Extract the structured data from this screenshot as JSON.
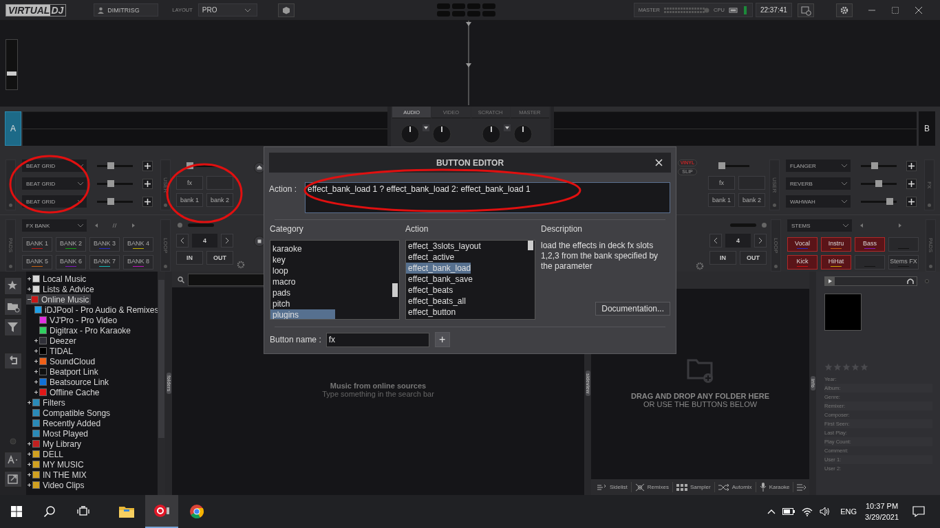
{
  "topbar": {
    "logo": {
      "part1": "VIRTUAL",
      "part2": "DJ"
    },
    "user": "DIMITRISG",
    "layout_label": "LAYOUT",
    "layout_value": "PRO",
    "master_label": "MASTER",
    "cpu_label": "CPU",
    "clock": "22:37:41"
  },
  "top_slider": {
    "level": 0.3
  },
  "mixer": {
    "tabs": [
      {
        "label": "AUDIO",
        "selected": true
      },
      {
        "label": "VIDEO",
        "selected": false
      },
      {
        "label": "SCRATCH",
        "selected": false
      },
      {
        "label": "MASTER",
        "selected": false
      }
    ]
  },
  "deck_a": {
    "label": "A",
    "pitch": {
      "level": 0
    },
    "effects": [
      {
        "name": "BEAT GRID",
        "level": 0.35
      },
      {
        "name": "BEAT GRID",
        "level": 0.35
      },
      {
        "name": "BEAT GRID",
        "level": 0.35
      }
    ],
    "user_strip": "USER",
    "user_buttons": [
      {
        "kind": "labeled",
        "label": "fx"
      },
      {
        "kind": "blank"
      },
      {
        "kind": "labeled",
        "label": "bank 1"
      },
      {
        "kind": "labeled",
        "label": "bank 2"
      }
    ],
    "pads_strip": "PADS",
    "pad_bank": "FX BANK",
    "pads": [
      {
        "kind": "labeled",
        "label": "BANK 1",
        "color": "#c01818",
        "active": false
      },
      {
        "kind": "labeled",
        "label": "BANK 2",
        "color": "#10a010",
        "active": false
      },
      {
        "kind": "labeled",
        "label": "BANK 3",
        "color": "#2828c8",
        "active": false
      },
      {
        "kind": "labeled",
        "label": "BANK 4",
        "color": "#c0b000",
        "active": false
      },
      {
        "kind": "labeled",
        "label": "BANK 5",
        "color": "#c86010",
        "active": false
      },
      {
        "kind": "labeled",
        "label": "BANK 6",
        "color": "#8018c0",
        "active": false
      },
      {
        "kind": "labeled",
        "label": "BANK 7",
        "color": "#10b8b8",
        "active": false
      },
      {
        "kind": "labeled",
        "label": "BANK 8",
        "color": "#c010c0",
        "active": false
      }
    ],
    "loop_strip": "LOOP",
    "loop_size": "4",
    "loop_in": "IN",
    "loop_out": "OUT"
  },
  "deck_b": {
    "label": "B",
    "vinyl": "VINYL",
    "slip": "SLIP",
    "pitch": {
      "level": 0
    },
    "user_buttons": [
      {
        "kind": "labeled",
        "label": "fx"
      },
      {
        "kind": "blank"
      },
      {
        "kind": "labeled",
        "label": "bank 1"
      },
      {
        "kind": "labeled",
        "label": "bank 2"
      }
    ],
    "user_strip": "USER",
    "effects": [
      {
        "name": "FLANGER",
        "level": 0.35
      },
      {
        "name": "REVERB",
        "level": 0.5
      },
      {
        "name": "WAHWAH",
        "level": 0.88
      }
    ],
    "fx_strip": "FX",
    "loop_size": "4",
    "loop_in": "IN",
    "loop_out": "OUT",
    "loop_strip": "LOOP",
    "pad_bank": "STEMS",
    "pads": [
      {
        "kind": "labeled",
        "label": "Vocal",
        "color": "#2828c8",
        "active": true
      },
      {
        "kind": "labeled",
        "label": "Instru",
        "color": "#c86010",
        "active": true
      },
      {
        "kind": "labeled",
        "label": "Bass",
        "color": "#8018c0",
        "active": true
      },
      {
        "kind": "blank",
        "color": "#111111",
        "active": false
      },
      {
        "kind": "labeled",
        "label": "Kick",
        "color": "#d01010",
        "active": true
      },
      {
        "kind": "labeled",
        "label": "HiHat",
        "color": "#d0a800",
        "active": true
      },
      {
        "kind": "blank",
        "color": "#111111",
        "active": false
      },
      {
        "kind": "labeled",
        "label": "Stems FX",
        "color": "#111111",
        "active": false
      }
    ],
    "pads_strip": "PADS"
  },
  "browser": {
    "tree": [
      {
        "label": "Local Music",
        "kind": "branch",
        "expanded": false,
        "color": "#d8d8d8",
        "selected": false
      },
      {
        "label": "Lists & Advice",
        "kind": "branch",
        "expanded": false,
        "color": "#d8d8d8",
        "selected": false
      },
      {
        "label": "Online Music",
        "kind": "branch",
        "expanded": true,
        "color": "#c81818",
        "selected": true,
        "children": [
          {
            "label": "iDJPool - Pro Audio & Remixes",
            "kind": "leaf",
            "color": "#1ea0e8",
            "selected": false
          },
          {
            "label": "VJ'Pro - Pro Video",
            "kind": "leaf",
            "color": "#e030e0",
            "selected": false
          },
          {
            "label": "Digitrax - Pro Karaoke",
            "kind": "leaf",
            "color": "#30d060",
            "selected": false
          },
          {
            "label": "Deezer",
            "kind": "branch",
            "expanded": false,
            "color": "#303038",
            "selected": false
          },
          {
            "label": "TIDAL",
            "kind": "branch",
            "expanded": false,
            "color": "#000000",
            "selected": false
          },
          {
            "label": "SoundCloud",
            "kind": "branch",
            "expanded": false,
            "color": "#f06018",
            "selected": false
          },
          {
            "label": "Beatport Link",
            "kind": "branch",
            "expanded": false,
            "color": "#101010",
            "selected": false
          },
          {
            "label": "Beatsource Link",
            "kind": "branch",
            "expanded": false,
            "color": "#1070d8",
            "selected": false
          },
          {
            "label": "Offline Cache",
            "kind": "branch",
            "expanded": false,
            "color": "#e01818",
            "selected": false
          }
        ]
      },
      {
        "label": "Filters",
        "kind": "branch",
        "expanded": false,
        "color": "#2a8ab8",
        "selected": false
      },
      {
        "label": "Compatible Songs",
        "kind": "leaf",
        "color": "#2a8ab8",
        "selected": false
      },
      {
        "label": "Recently Added",
        "kind": "leaf",
        "color": "#2a8ab8",
        "selected": false
      },
      {
        "label": "Most Played",
        "kind": "leaf",
        "color": "#2a8ab8",
        "selected": false
      },
      {
        "label": "My Library",
        "kind": "branch",
        "expanded": false,
        "color": "#c02020",
        "selected": false
      },
      {
        "label": "DELL",
        "kind": "branch",
        "expanded": false,
        "color": "#d0a020",
        "selected": false
      },
      {
        "label": "MY MUSIC",
        "kind": "branch",
        "expanded": false,
        "color": "#d0a020",
        "selected": false
      },
      {
        "label": "IN THE MIX",
        "kind": "branch",
        "expanded": false,
        "color": "#d0a020",
        "selected": false
      },
      {
        "label": "Video Clips",
        "kind": "branch",
        "expanded": false,
        "color": "#d0a020",
        "selected": false
      }
    ],
    "folders_tab": "folders",
    "center_message": "Music from online sources",
    "center_hint": "Type something in the search bar",
    "sideview_tab": "sideview",
    "drop_message_1": "DRAG AND DROP ANY FOLDER HERE",
    "drop_message_2": "OR USE THE BUTTONS BELOW",
    "sideview_buttons": [
      "Sidelist",
      "Remixes",
      "Sampler",
      "Automix",
      "Karaoke"
    ],
    "info_tab": "info",
    "info": {
      "stars": 0,
      "fields": [
        "Year:",
        "Album:",
        "Genre:",
        "Remixer:",
        "Composer:",
        "First Seen:",
        "Last Play:",
        "Play Count:",
        "Comment:",
        "User 1:",
        "User 2:"
      ]
    }
  },
  "dialog": {
    "title": "BUTTON EDITOR",
    "action_label": "Action :",
    "action_value": "effect_bank_load 1 ? effect_bank_load 2: effect_bank_load 1",
    "category_heading": "Category",
    "categories": [
      {
        "label": "karaoke",
        "selected": false
      },
      {
        "label": "key",
        "selected": false
      },
      {
        "label": "loop",
        "selected": false
      },
      {
        "label": "macro",
        "selected": false
      },
      {
        "label": "pads",
        "selected": false
      },
      {
        "label": "pitch",
        "selected": false
      },
      {
        "label": "plugins",
        "selected": true
      }
    ],
    "action_heading": "Action",
    "actions": [
      {
        "label": "effect_3slots_layout",
        "selected": false
      },
      {
        "label": "effect_active",
        "selected": false
      },
      {
        "label": "effect_bank_load",
        "selected": true
      },
      {
        "label": "effect_bank_save",
        "selected": false
      },
      {
        "label": "effect_beats",
        "selected": false
      },
      {
        "label": "effect_beats_all",
        "selected": false
      },
      {
        "label": "effect_button",
        "selected": false
      }
    ],
    "description_heading": "Description",
    "description": "load the effects in deck fx slots 1,2,3 from the bank specified by the parameter",
    "documentation_button": "Documentation...",
    "name_label": "Button name :",
    "name_value": "fx",
    "add_button": "+"
  },
  "taskbar": {
    "apps": [
      {
        "kind": "explorer",
        "selected": false
      },
      {
        "kind": "virtualdj",
        "selected": true
      },
      {
        "kind": "chrome",
        "selected": false
      }
    ],
    "language": "ENG",
    "time": "10:37 PM",
    "date": "3/29/2021"
  }
}
